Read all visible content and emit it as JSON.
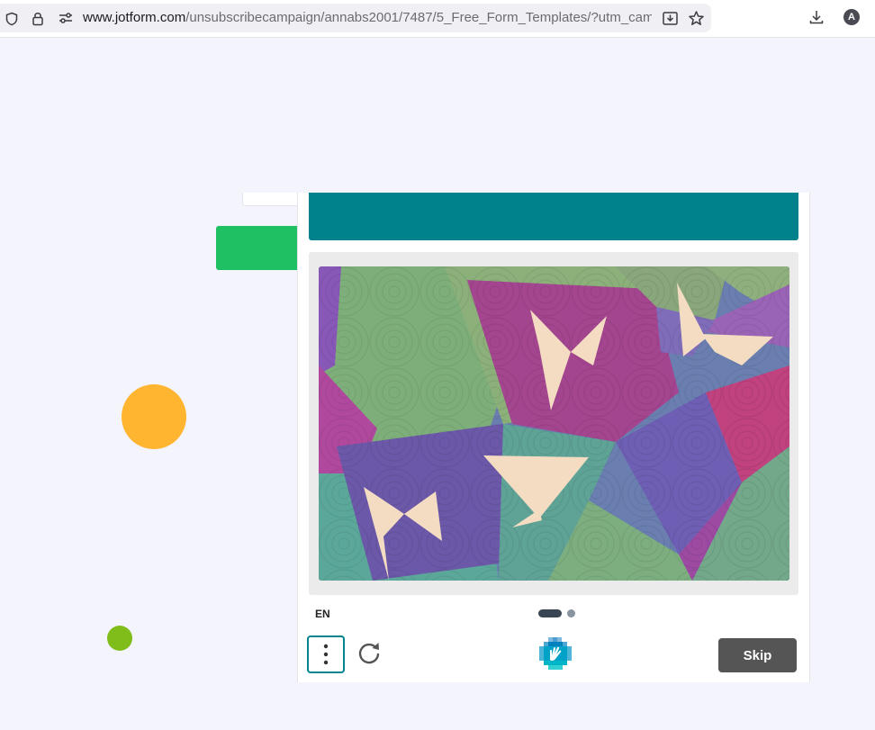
{
  "browser": {
    "url_host": "www.jotform.com",
    "url_path": "/unsubscribecampaign/annabs2001/7487/5_Free_Form_Templates/?utm_campa",
    "profile_initial": "A",
    "icons": [
      "shield-icon",
      "lock-icon",
      "site-settings-icon",
      "save-page-icon",
      "bookmark-star-icon",
      "download-icon"
    ]
  },
  "captcha": {
    "language": "EN",
    "skip_label": "Skip",
    "page_count": 2,
    "current_page": 1,
    "colors": {
      "prompt_bar": "#00828c",
      "skip_button": "#555555",
      "menu_border": "#00838f"
    },
    "icons": [
      "menu-dots-icon",
      "refresh-icon",
      "hcaptcha-logo-icon"
    ]
  },
  "page": {
    "colors": {
      "background": "#f4f4fd",
      "green_button": "#1fbf64",
      "orange_dot": "#ffb52f",
      "lime_dot": "#80bd1b"
    }
  }
}
